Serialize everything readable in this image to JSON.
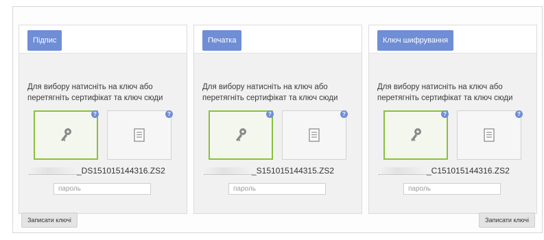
{
  "panels": [
    {
      "tab_label": "Підпис",
      "instruction": "Для вибору натисніть на ключ або перетягніть сертифікат та ключ сюди",
      "file_suffix": "_DS151015144316.ZS2",
      "password_placeholder": "пароль"
    },
    {
      "tab_label": "Печатка",
      "instruction": "Для вибору натисніть на ключ або перетягніть сертифікат та ключ сюди",
      "file_suffix": "_S151015144315.ZS2",
      "password_placeholder": "пароль"
    },
    {
      "tab_label": "Ключ шифрування",
      "instruction": "Для вибору натисніть на ключ або перетягніть сертифікат та ключ сюди",
      "file_suffix": "_C151015144316.ZS2",
      "password_placeholder": "пароль"
    }
  ],
  "buttons": {
    "left_label": "Записати ключі",
    "right_label": "Записати ключі"
  },
  "help_glyph": "?",
  "icons": {
    "key": "key-icon",
    "certificate": "certificate-icon",
    "help": "help-icon"
  },
  "colors": {
    "tab": "#6f8ed6",
    "selected_border": "#8bbf3c"
  }
}
